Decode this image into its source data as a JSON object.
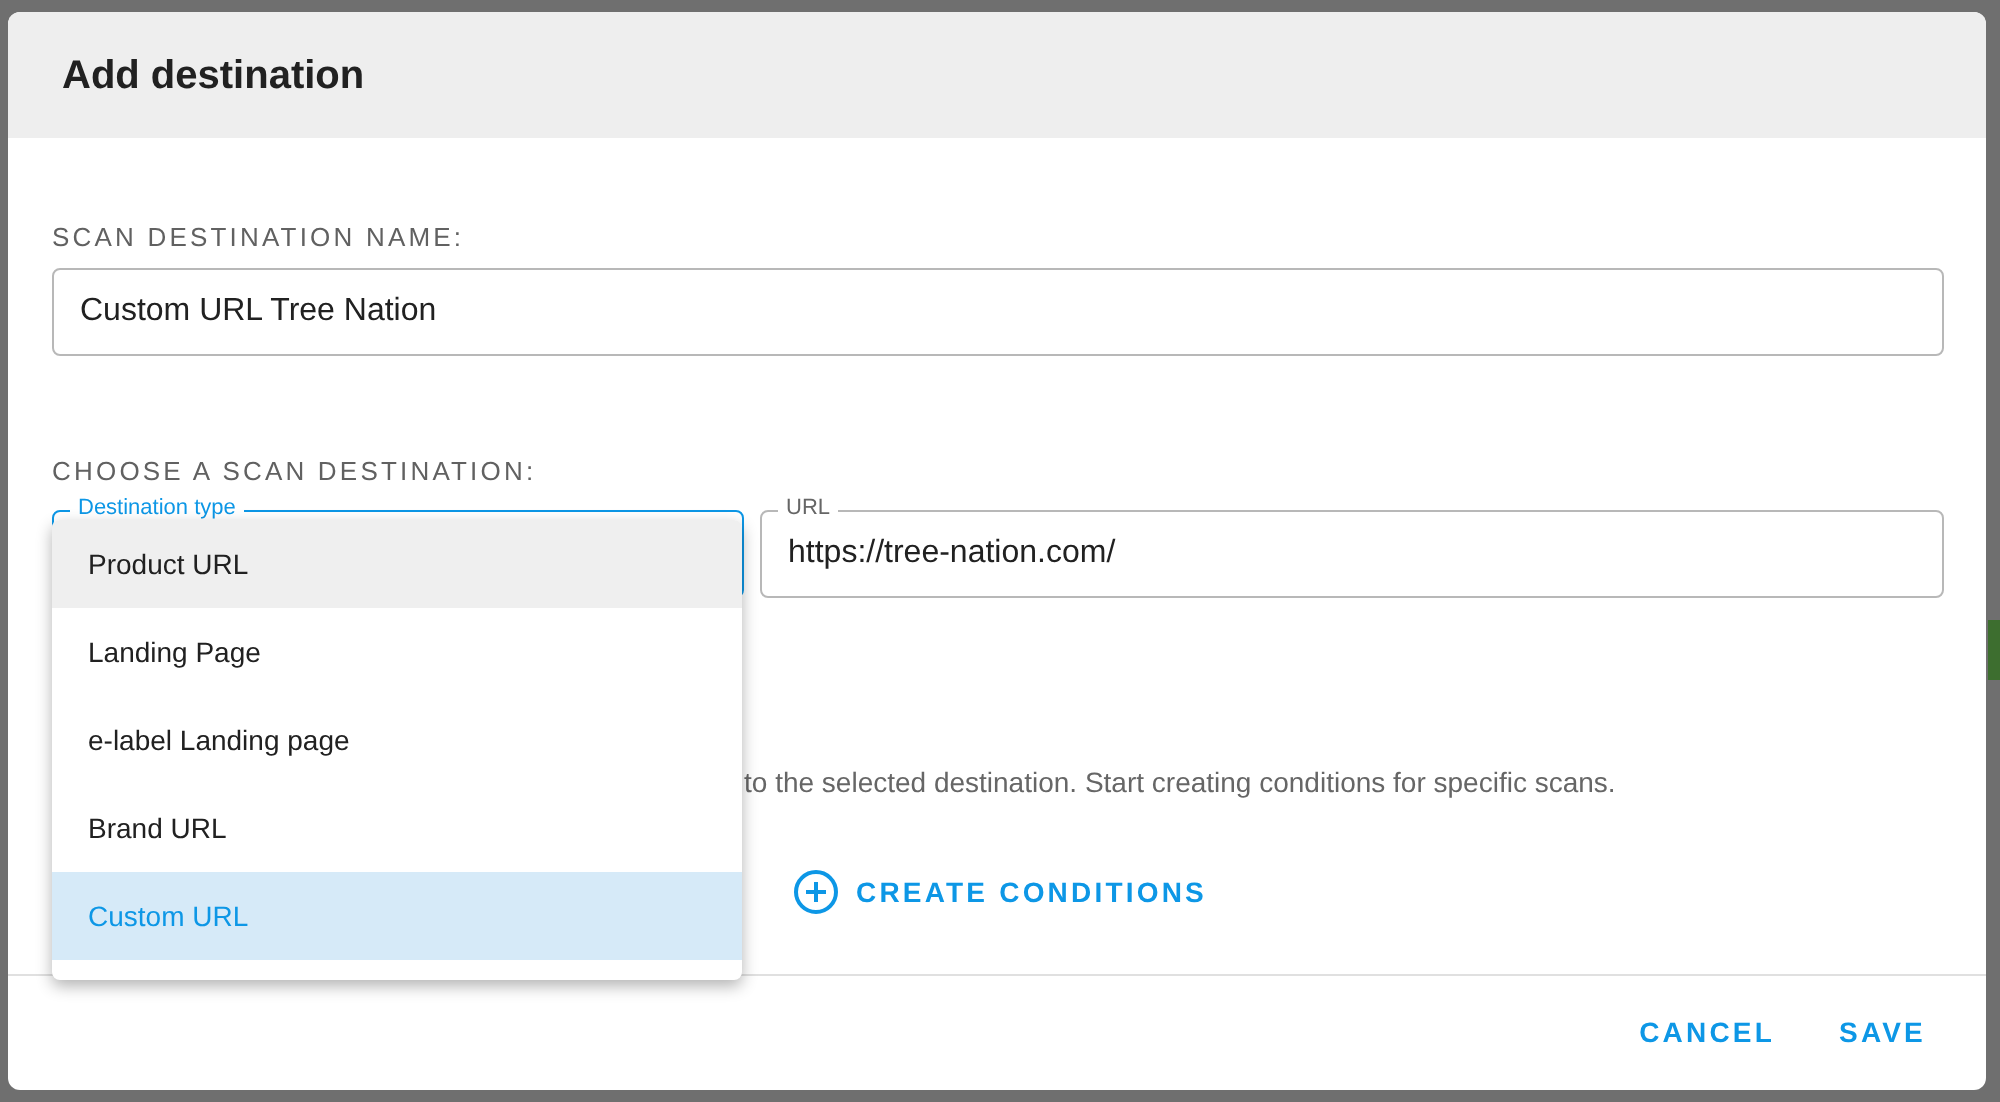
{
  "dialog": {
    "title": "Add destination"
  },
  "name_field": {
    "label": "SCAN DESTINATION NAME:",
    "value": "Custom URL Tree Nation"
  },
  "destination_section": {
    "label": "CHOOSE A SCAN DESTINATION:"
  },
  "destination_type": {
    "label": "Destination type",
    "expanded": true,
    "options": [
      {
        "label": "Product URL",
        "selected": false,
        "hovered": true
      },
      {
        "label": "Landing Page",
        "selected": false,
        "hovered": false
      },
      {
        "label": "e-label Landing page",
        "selected": false,
        "hovered": false
      },
      {
        "label": "Brand URL",
        "selected": false,
        "hovered": false
      },
      {
        "label": "Custom URL",
        "selected": true,
        "hovered": false
      }
    ]
  },
  "url_field": {
    "label": "URL",
    "value": "https://tree-nation.com/"
  },
  "conditions": {
    "hint": "to the selected destination. Start creating conditions for specific scans.",
    "button": "CREATE CONDITIONS"
  },
  "buttons": [
    "CANCEL",
    "SAVE"
  ]
}
